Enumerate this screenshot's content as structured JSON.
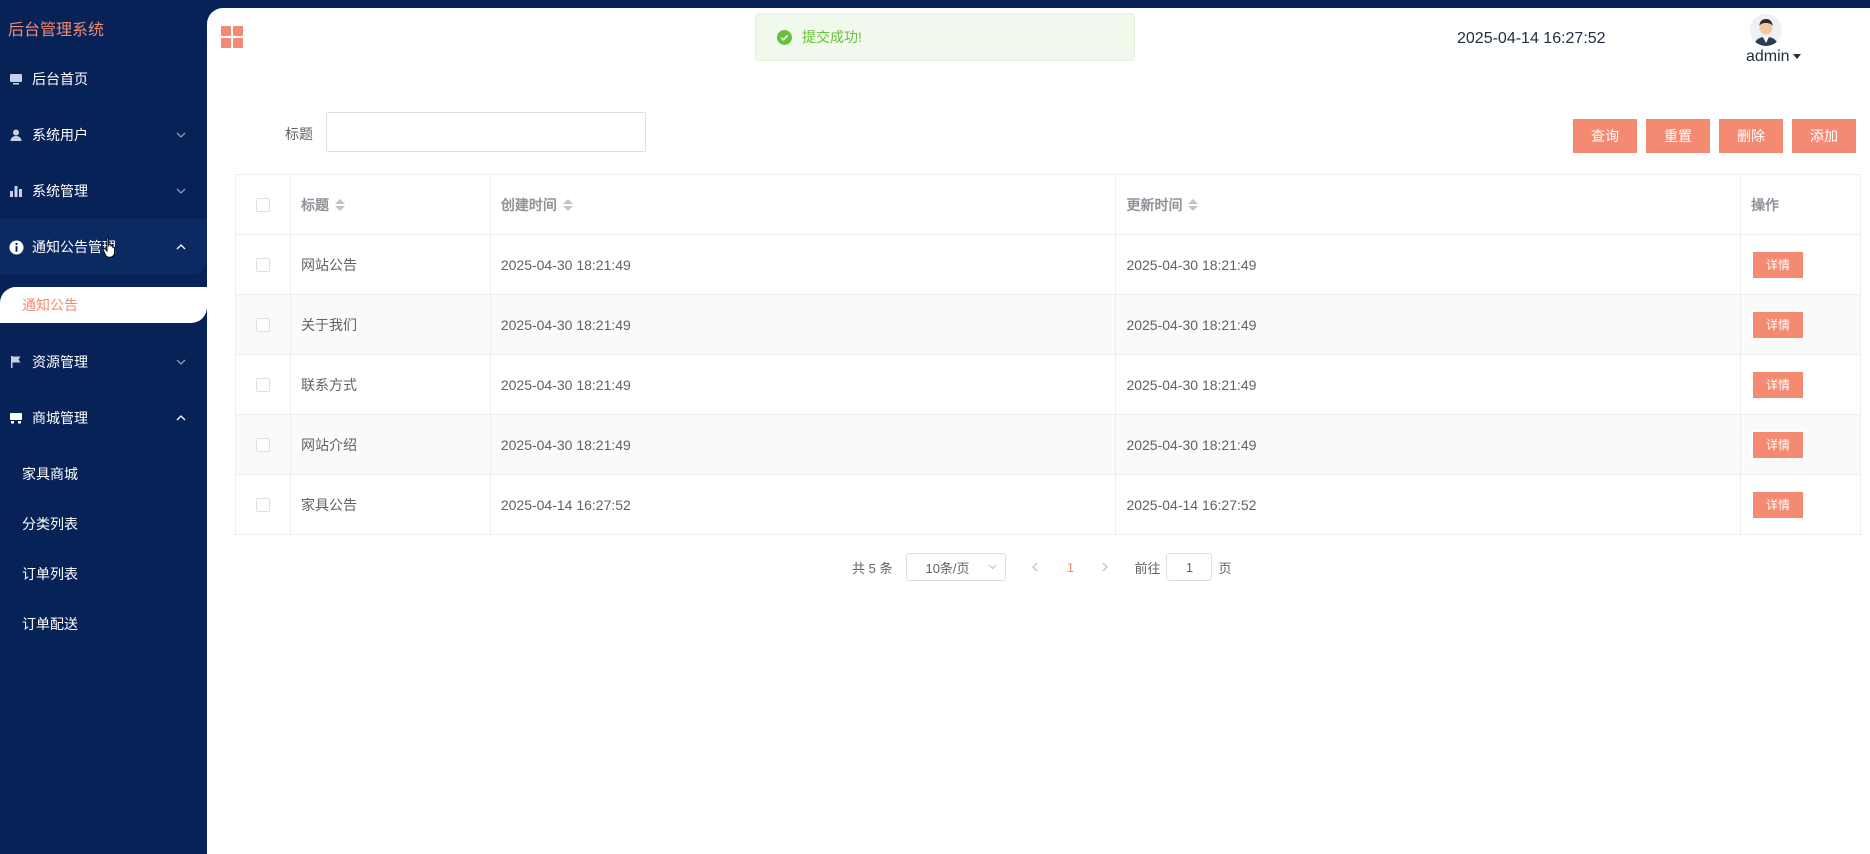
{
  "app": {
    "brand": "后台管理系统"
  },
  "sidebar": {
    "items": [
      {
        "label": "后台首页",
        "icon": "monitor-icon"
      },
      {
        "label": "系统用户",
        "icon": "user-icon"
      },
      {
        "label": "系统管理",
        "icon": "bar-chart-icon"
      },
      {
        "label": "通知公告管理",
        "icon": "info-icon"
      },
      {
        "label": "资源管理",
        "icon": "flag-icon"
      },
      {
        "label": "商城管理",
        "icon": "shop-icon"
      }
    ],
    "notice_sub": [
      {
        "label": "通知公告"
      }
    ],
    "shop_sub": [
      {
        "label": "家具商城"
      },
      {
        "label": "分类列表"
      },
      {
        "label": "订单列表"
      },
      {
        "label": "订单配送"
      }
    ]
  },
  "header": {
    "toast": "提交成功!",
    "datetime": "2025-04-14 16:27:52",
    "username": "admin"
  },
  "search": {
    "label": "标题",
    "value": "",
    "placeholder": ""
  },
  "toolbar": {
    "query": "查询",
    "reset": "重置",
    "delete": "删除",
    "add": "添加"
  },
  "table": {
    "headers": {
      "title": "标题",
      "created": "创建时间",
      "updated": "更新时间",
      "actions": "操作"
    },
    "detail_label": "详情",
    "rows": [
      {
        "title": "网站公告",
        "created": "2025-04-30 18:21:49",
        "updated": "2025-04-30 18:21:49"
      },
      {
        "title": "关于我们",
        "created": "2025-04-30 18:21:49",
        "updated": "2025-04-30 18:21:49"
      },
      {
        "title": "联系方式",
        "created": "2025-04-30 18:21:49",
        "updated": "2025-04-30 18:21:49"
      },
      {
        "title": "网站介绍",
        "created": "2025-04-30 18:21:49",
        "updated": "2025-04-30 18:21:49"
      },
      {
        "title": "家具公告",
        "created": "2025-04-14 16:27:52",
        "updated": "2025-04-14 16:27:52"
      }
    ]
  },
  "pagination": {
    "total": "共 5 条",
    "page_size": "10条/页",
    "current_page": "1",
    "goto_prefix": "前往",
    "goto_value": "1",
    "goto_suffix": "页"
  },
  "colors": {
    "sidebar_bg": "#062257",
    "accent": "#f48a72",
    "success": "#67c23a"
  }
}
